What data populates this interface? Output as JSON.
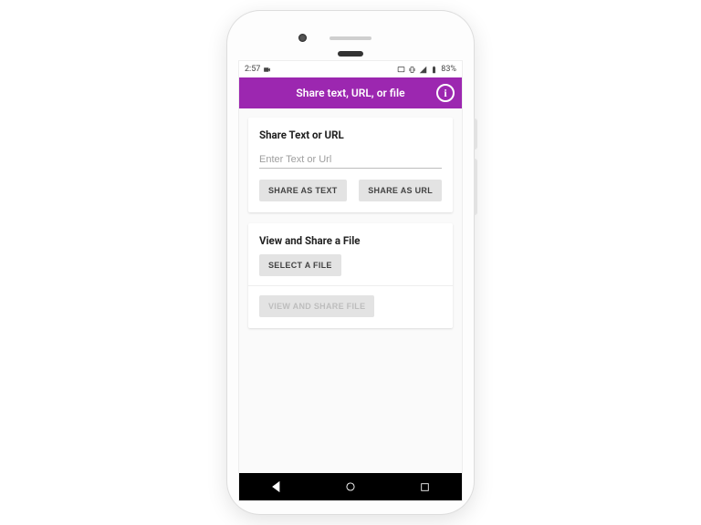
{
  "statusbar": {
    "time": "2:57",
    "battery": "83%"
  },
  "appbar": {
    "title": "Share text, URL, or file",
    "info_glyph": "i"
  },
  "card1": {
    "title": "Share Text or URL",
    "placeholder": "Enter Text or Url",
    "btn_text": "SHARE AS TEXT",
    "btn_url": "SHARE AS URL"
  },
  "card2": {
    "title": "View and Share a File",
    "btn_select": "SELECT A FILE",
    "btn_view": "VIEW AND SHARE FILE"
  }
}
